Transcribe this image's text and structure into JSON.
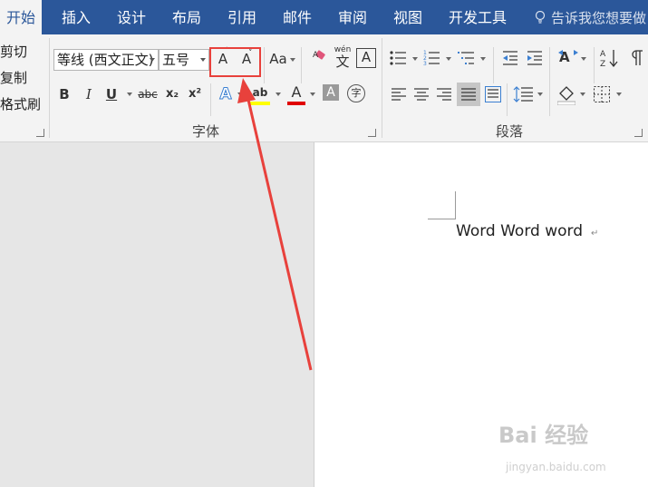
{
  "tabs": [
    {
      "label": "开始",
      "active": true
    },
    {
      "label": "插入"
    },
    {
      "label": "设计"
    },
    {
      "label": "布局"
    },
    {
      "label": "引用"
    },
    {
      "label": "邮件"
    },
    {
      "label": "审阅"
    },
    {
      "label": "视图"
    },
    {
      "label": "开发工具"
    }
  ],
  "tell_me": "告诉我您想要做",
  "clipboard": {
    "cut": "剪切",
    "copy": "复制",
    "format_painter": "格式刷"
  },
  "font": {
    "font_name": "等线 (西文正文)",
    "font_size": "五号",
    "grow": "A",
    "shrink": "A",
    "change_case": "Aa",
    "phonetic_top": "wén",
    "phonetic_char": "文",
    "border_char": "A",
    "bold": "B",
    "italic": "I",
    "underline": "U",
    "strike": "abc",
    "subscript": "x₂",
    "superscript": "x²",
    "effects": "A",
    "highlight": "ab",
    "color": "A",
    "shading": "A",
    "enclose": "字",
    "group_label": "字体"
  },
  "paragraph": {
    "group_label": "段落"
  },
  "document": {
    "text": "Word Word word",
    "para_mark": "↵"
  },
  "watermark": {
    "logo": "Bai 经验",
    "sub": "jingyan.baidu.com"
  },
  "colors": {
    "accent": "#2b579a",
    "highlight_box": "#e8413c",
    "highlight_yellow": "#ffff00",
    "font_red": "#e00000"
  }
}
